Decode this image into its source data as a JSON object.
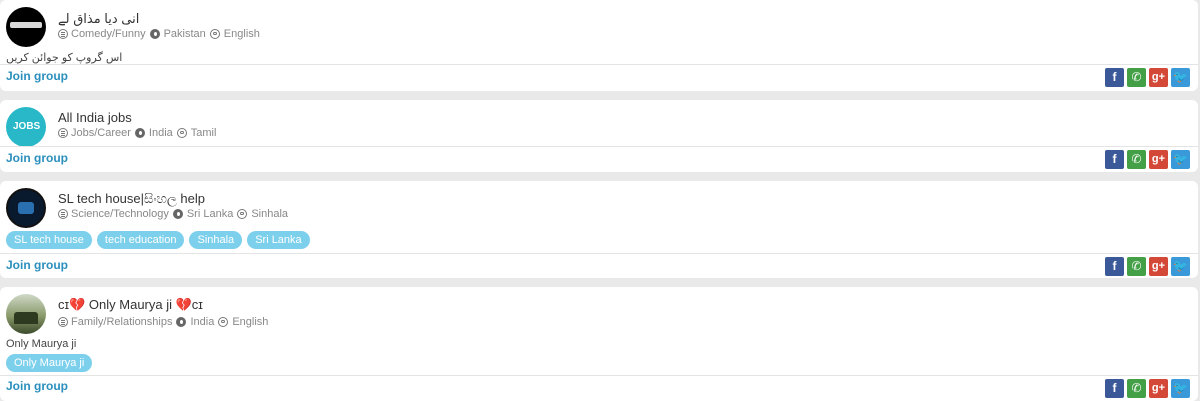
{
  "colors": {
    "link": "#2a8fbd",
    "tag_bg": "#7cd0ec",
    "facebook": "#3b5998",
    "whatsapp": "#43a047",
    "googleplus": "#d34836",
    "twitter": "#3a9ad9"
  },
  "share_icons": {
    "facebook": "f",
    "whatsapp": "✆",
    "googleplus": "g+",
    "twitter": "🐦"
  },
  "join_label": "Join group",
  "groups": [
    {
      "title": "انی دیا مذاق لے",
      "category": "Comedy/Funny",
      "country": "Pakistan",
      "language": "English",
      "description": "اس گروپ کو جوائن کریں",
      "tags": [],
      "avatar_icon": "urdu-logo-avatar"
    },
    {
      "title": "All India jobs",
      "category": "Jobs/Career",
      "country": "India",
      "language": "Tamil",
      "description": "",
      "tags": [],
      "avatar_icon": "jobs-logo-avatar",
      "avatar_text": "JOBS"
    },
    {
      "title": "SL tech house|සිංහල help",
      "category": "Science/Technology",
      "country": "Sri Lanka",
      "language": "Sinhala",
      "description": "",
      "tags": [
        "SL tech house",
        "tech education",
        "Sinhala",
        "Sri Lanka"
      ],
      "avatar_icon": "tech-house-avatar"
    },
    {
      "title": "cɪ💔 Only Maurya ji 💔cɪ",
      "category": "Family/Relationships",
      "country": "India",
      "language": "English",
      "description": "Only Maurya ji",
      "tags": [
        "Only Maurya ji"
      ],
      "avatar_icon": "photo-avatar"
    }
  ]
}
